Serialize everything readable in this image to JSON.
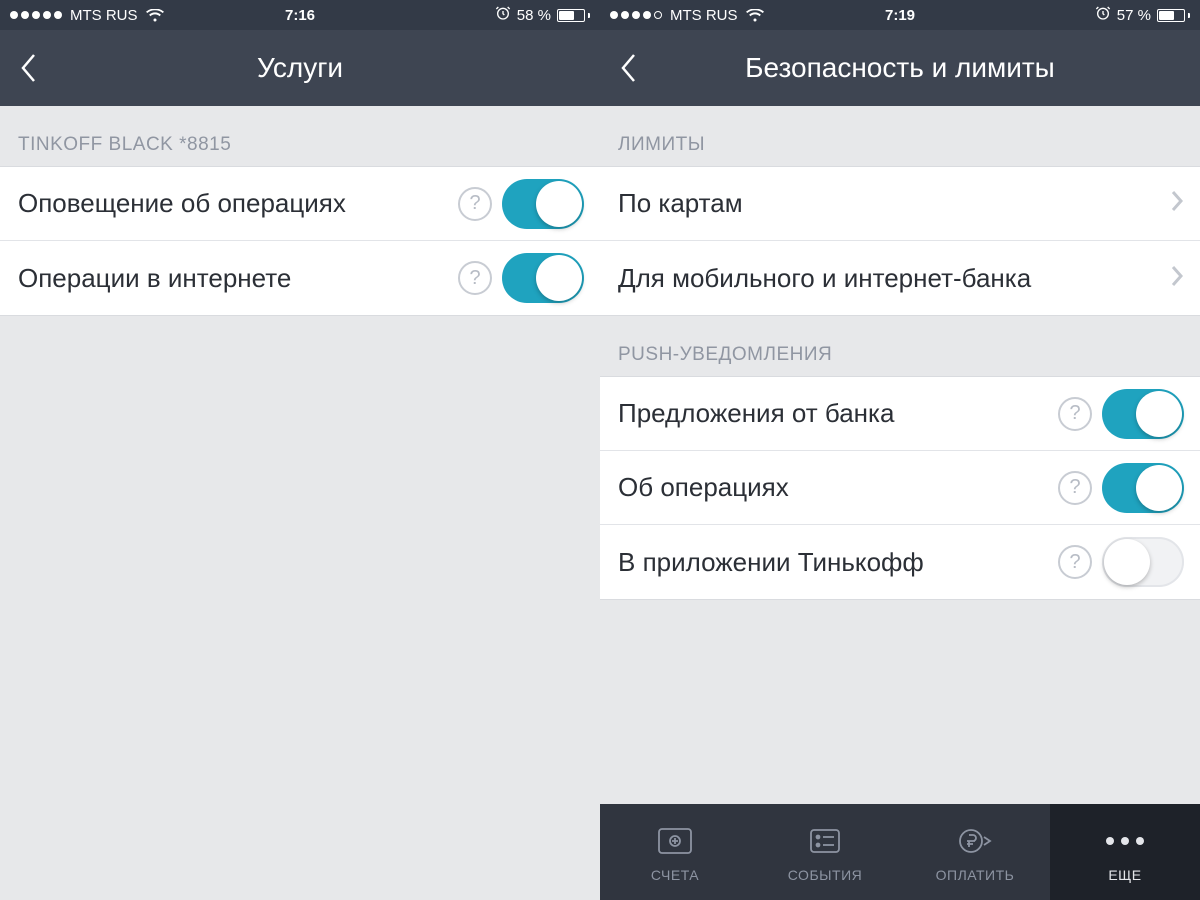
{
  "left": {
    "status": {
      "carrier": "MTS RUS",
      "time": "7:16",
      "battery_pct": "58 %",
      "filled_dots": 5,
      "battery_fill": 58
    },
    "nav": {
      "title": "Услуги"
    },
    "section_header": "TINKOFF BLACK *8815",
    "rows": [
      {
        "label": "Оповещение об операциях",
        "help": "?",
        "toggle": true
      },
      {
        "label": "Операции в интернете",
        "help": "?",
        "toggle": true
      }
    ]
  },
  "right": {
    "status": {
      "carrier": "MTS RUS",
      "time": "7:19",
      "battery_pct": "57 %",
      "filled_dots": 4,
      "battery_fill": 57
    },
    "nav": {
      "title": "Безопасность и лимиты"
    },
    "sections": {
      "limits_header": "ЛИМИТЫ",
      "limits_rows": [
        {
          "label": "По картам"
        },
        {
          "label": "Для мобильного и интернет-банка"
        }
      ],
      "push_header": "PUSH-УВЕДОМЛЕНИЯ",
      "push_rows": [
        {
          "label": "Предложения от банка",
          "help": "?",
          "toggle": true
        },
        {
          "label": "Об операциях",
          "help": "?",
          "toggle": true
        },
        {
          "label": "В приложении Тинькофф",
          "help": "?",
          "toggle": false
        }
      ]
    },
    "tabs": [
      {
        "label": "СЧЕТА"
      },
      {
        "label": "СОБЫТИЯ"
      },
      {
        "label": "ОПЛАТИТЬ"
      },
      {
        "label": "ЕЩЕ"
      }
    ]
  },
  "icons": {
    "alarm": "⏰"
  }
}
